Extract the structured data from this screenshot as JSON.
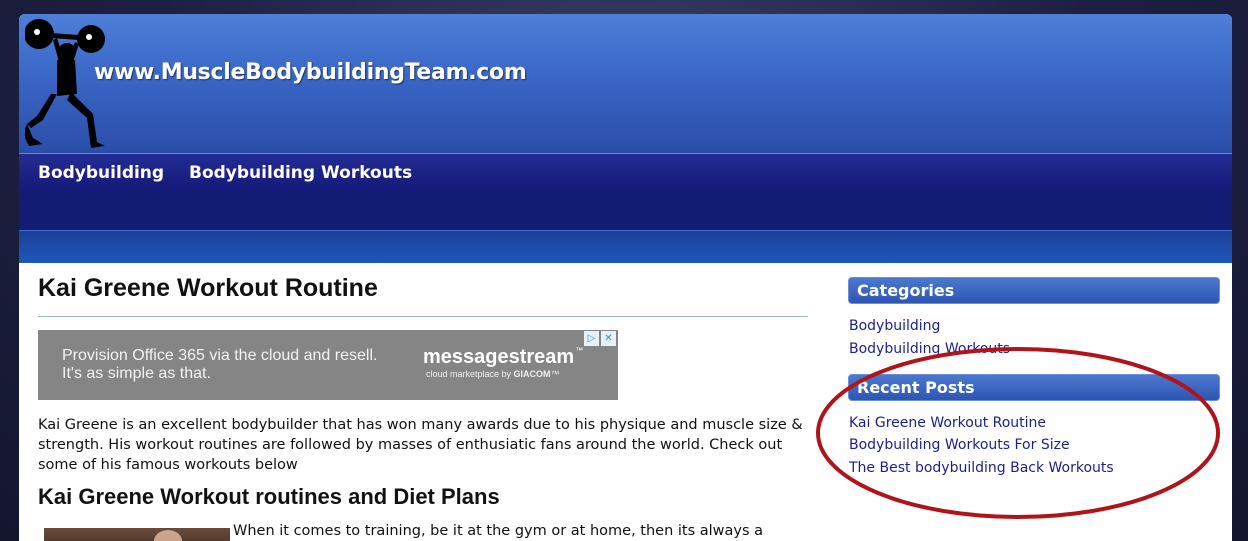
{
  "site": {
    "title": "www.MuscleBodybuildingTeam.com"
  },
  "nav": {
    "items": [
      "Bodybuilding",
      "Bodybuilding Workouts"
    ]
  },
  "article": {
    "title": "Kai Greene Workout Routine",
    "intro": "Kai Greene is an excellent bodybuilder that has won many awards due to his physique and muscle size & strength. His workout routines are followed by masses of enthusiatic fans around the world. Check out some of his famous workouts below",
    "subheading": "Kai Greene Workout routines and Diet Plans",
    "body_start": "When it comes to training, be it at the gym or at home, then its always a"
  },
  "ad": {
    "text_line1": "Provision Office 365 via the cloud and resell.",
    "text_line2": "It's as simple as that.",
    "brand": "messagestream",
    "brand_tm": "™",
    "tagline_prefix": "cloud marketplace by ",
    "tagline_company": "GIACOM",
    "tagline_tm": "™",
    "adchoices_icon": "▷",
    "close_icon": "✕"
  },
  "sidebar": {
    "categories_title": "Categories",
    "categories": [
      "Bodybuilding",
      "Bodybuilding Workouts"
    ],
    "recent_title": "Recent Posts",
    "recent_posts": [
      "Kai Greene Workout Routine",
      "Bodybuilding Workouts For Size",
      "The Best bodybuilding Back Workouts"
    ]
  },
  "colors": {
    "header_blue": "#3a66c6",
    "nav_navy": "#141a78",
    "link": "#1a1f8f",
    "annotation_red": "#b0141a"
  }
}
